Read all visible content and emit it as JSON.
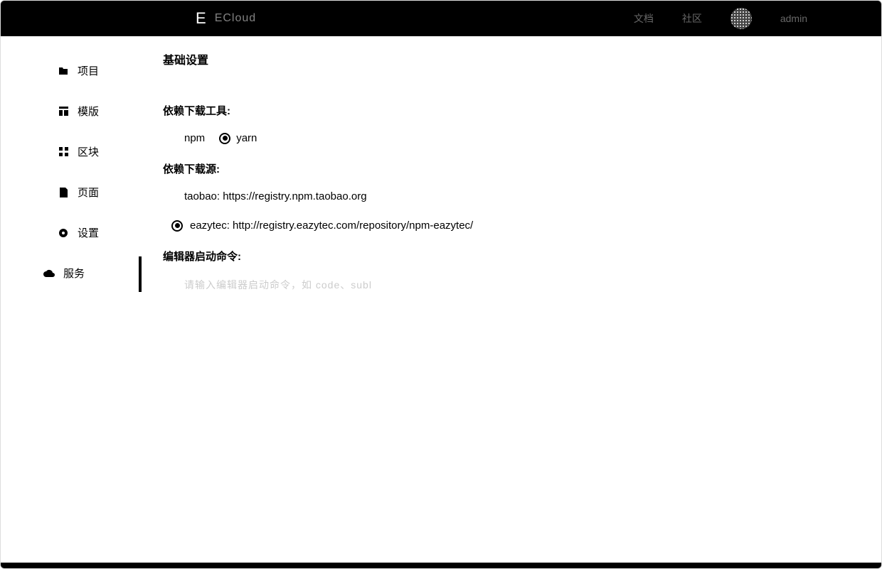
{
  "header": {
    "logo_letter": "E",
    "logo_text": "ECloud",
    "link1": "文档",
    "link2": "社区",
    "username": "admin"
  },
  "sidebar": {
    "items": [
      {
        "label": "项目",
        "icon": "folder"
      },
      {
        "label": "模版",
        "icon": "template"
      },
      {
        "label": "区块",
        "icon": "block"
      },
      {
        "label": "页面",
        "icon": "page"
      },
      {
        "label": "设置",
        "icon": "gear",
        "active": true
      },
      {
        "label": "服务",
        "icon": "cloud"
      }
    ]
  },
  "main": {
    "title": "基础设置",
    "tool_label": "依赖下载工具:",
    "tool_options": [
      {
        "value": "npm",
        "label": "npm",
        "selected": false
      },
      {
        "value": "yarn",
        "label": "yarn",
        "selected": true
      }
    ],
    "registry_label": "依赖下载源:",
    "registry_options": [
      {
        "label": "taobao: https://registry.npm.taobao.org",
        "selected": false
      },
      {
        "label": "eazytec: http://registry.eazytec.com/repository/npm-eazytec/",
        "selected": true
      }
    ],
    "editor_label": "编辑器启动命令:",
    "editor_placeholder": "请输入编辑器启动命令，如 code、subl"
  }
}
